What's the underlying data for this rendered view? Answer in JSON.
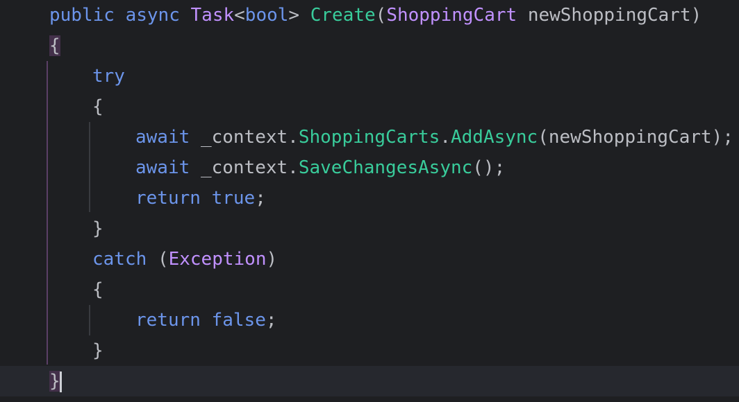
{
  "code": {
    "method_signature": {
      "modifier_public": "public",
      "modifier_async": "async",
      "return_type": "Task",
      "generic_open": "<",
      "generic_arg": "bool",
      "generic_close": ">",
      "method_name": "Create",
      "paren_open": "(",
      "param_type": "ShoppingCart",
      "param_name": "newShoppingCart",
      "paren_close": ")"
    },
    "open_brace": "{",
    "try_keyword": "try",
    "try_open_brace": "{",
    "line_add": {
      "await": "await",
      "context": "_context",
      "dot1": ".",
      "member": "ShoppingCarts",
      "dot2": ".",
      "method": "AddAsync",
      "args": "(newShoppingCart);"
    },
    "line_save": {
      "await": "await",
      "context": "_context",
      "dot": ".",
      "method": "SaveChangesAsync",
      "args": "();"
    },
    "line_return_true": {
      "return": "return",
      "value": "true",
      "semicolon": ";"
    },
    "try_close_brace": "}",
    "catch_line": {
      "catch": "catch",
      "paren_open": "(",
      "exception_type": "Exception",
      "paren_close": ")"
    },
    "catch_open_brace": "{",
    "line_return_false": {
      "return": "return",
      "value": "false",
      "semicolon": ";"
    },
    "catch_close_brace": "}",
    "close_brace": "}"
  },
  "colors": {
    "background": "#1e1f22",
    "current_line": "#26282e",
    "keyword": "#6c95eb",
    "type": "#c191ff",
    "method": "#39cc9b",
    "plain": "#bcbec4",
    "brace_match": "#43304a"
  }
}
